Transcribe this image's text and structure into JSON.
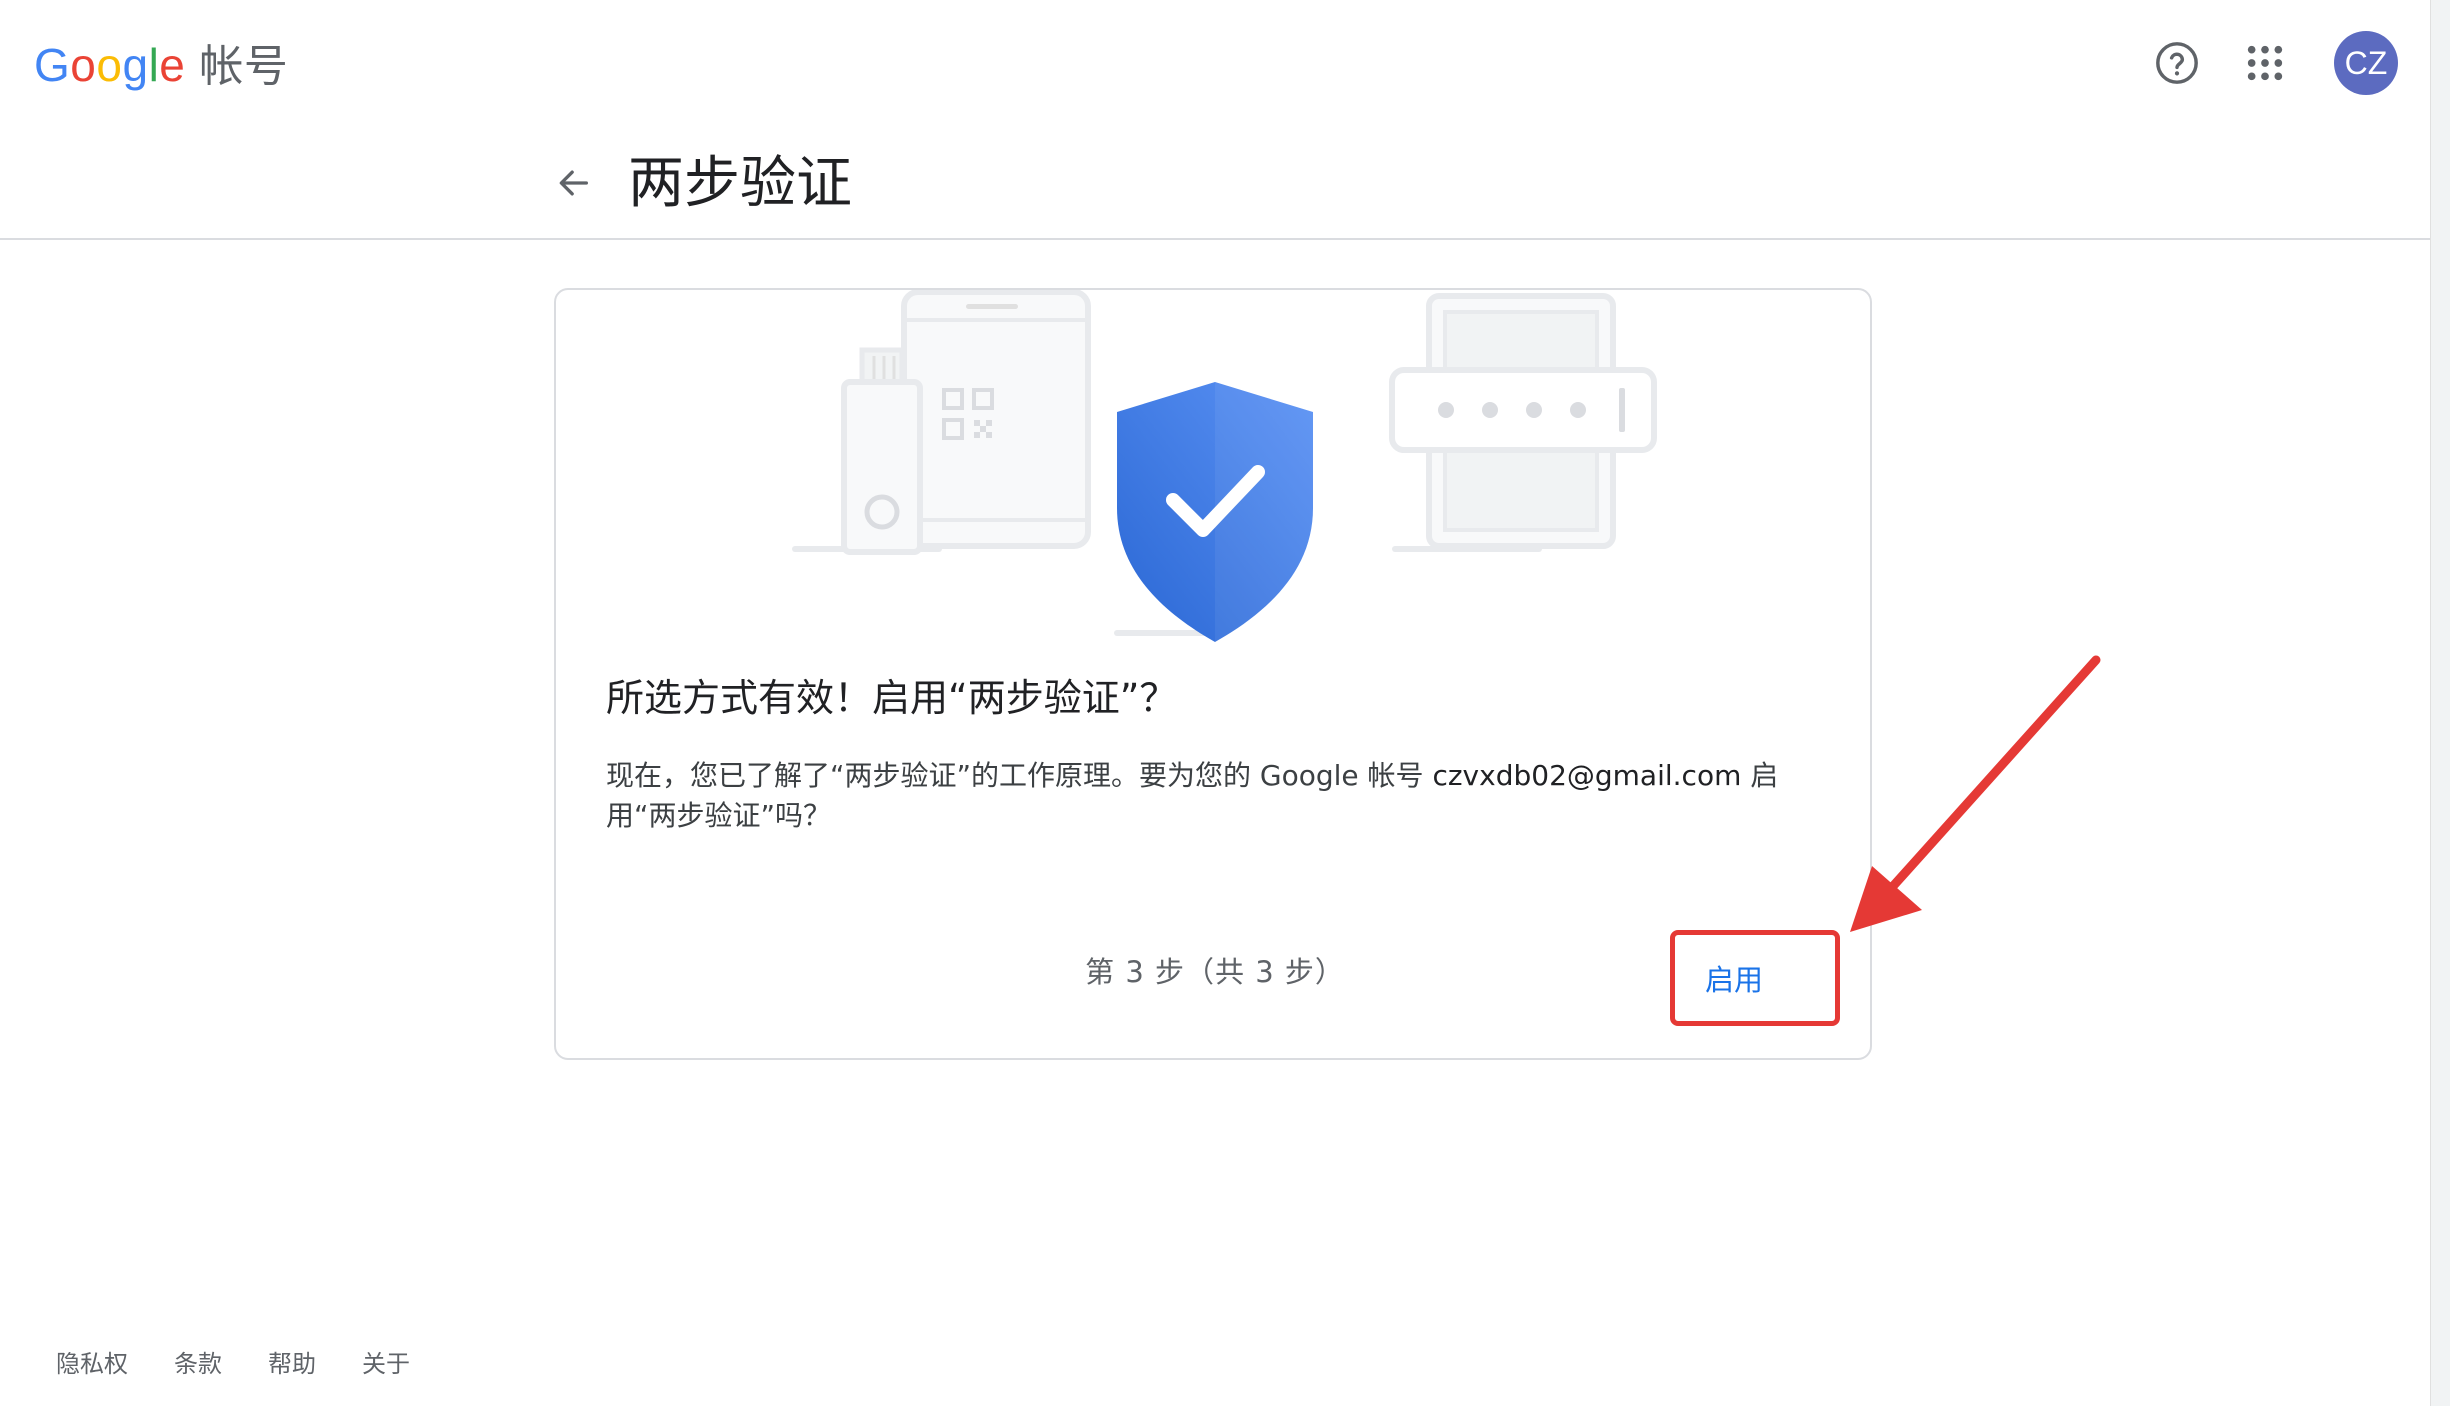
{
  "header": {
    "brand_letters": [
      "G",
      "o",
      "o",
      "g",
      "l",
      "e"
    ],
    "product_name": "帐号",
    "help_icon": "help-circle-icon",
    "apps_icon": "apps-grid-icon",
    "avatar_initials": "CZ"
  },
  "page": {
    "title": "两步验证",
    "back_icon": "arrow-back-icon"
  },
  "card": {
    "illustration": {
      "left": "security-key-and-phone-illustration",
      "center": "shield-checkmark-illustration",
      "right": "password-field-illustration"
    },
    "heading": "所选方式有效！启用“两步验证”？",
    "body_before": "现在，您已了解了“两步验证”的工作原理。要为您的 Google 帐号 ",
    "body_email": "czvxdb02@gmail.com",
    "body_after": " 启用“两步验证”吗？",
    "step_counter": "第 3 步（共 3 步）",
    "enable_button": "启用"
  },
  "footer": {
    "links": [
      "隐私权",
      "条款",
      "帮助",
      "关于"
    ]
  },
  "colors": {
    "google_blue": "#4285f4",
    "google_red": "#ea4335",
    "google_yellow": "#fbbc05",
    "google_green": "#34a853",
    "link_blue": "#1a73e8",
    "avatar_bg": "#5c6bc0",
    "annotation_red": "#e53935"
  }
}
